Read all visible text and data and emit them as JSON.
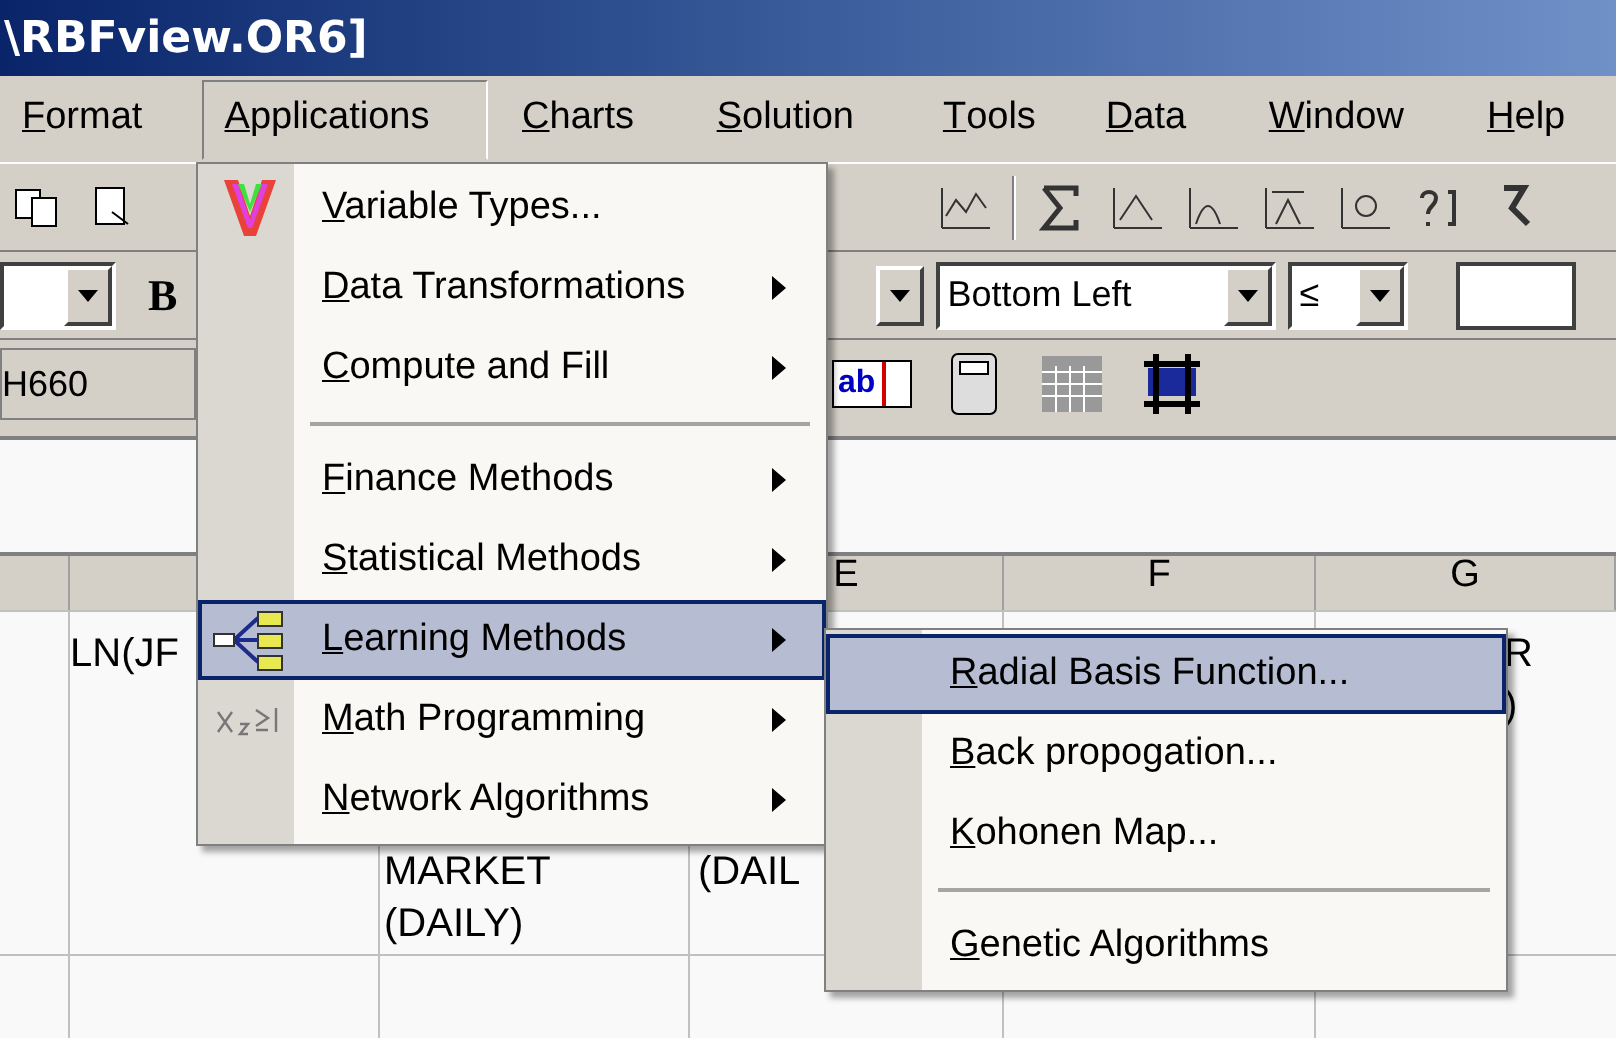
{
  "window": {
    "title": "\\RBFview.OR6]"
  },
  "menubar": [
    {
      "label": "Format",
      "selected": false
    },
    {
      "label": "Applications",
      "selected": true
    },
    {
      "label": "Charts",
      "selected": false
    },
    {
      "label": "Solution",
      "selected": false
    },
    {
      "label": "Tools",
      "selected": false
    },
    {
      "label": "Data",
      "selected": false
    },
    {
      "label": "Window",
      "selected": false
    },
    {
      "label": "Help",
      "selected": false
    }
  ],
  "format_toolbar": {
    "bold_label": "B",
    "position_value": "Bottom Left",
    "operator_value": "≤"
  },
  "cell_reference": "H660",
  "text_tool_label": "ab",
  "sheet": {
    "columns": [
      "E",
      "F",
      "G"
    ],
    "cells": [
      "LN(JF",
      "MARKET\n(DAILY)",
      "(DAIL",
      "R\n)"
    ]
  },
  "applications_menu": [
    {
      "kind": "logo_item",
      "label": "Variable Types...",
      "submenu": false,
      "selected": false
    },
    {
      "kind": "item",
      "label": "Data Transformations",
      "submenu": true,
      "selected": false
    },
    {
      "kind": "item",
      "label": "Compute and Fill",
      "submenu": true,
      "selected": false
    },
    {
      "kind": "separator"
    },
    {
      "kind": "item",
      "label": "Finance Methods",
      "submenu": true,
      "selected": false
    },
    {
      "kind": "item",
      "label": "Statistical Methods",
      "submenu": true,
      "selected": false
    },
    {
      "kind": "tree_item",
      "label": "Learning Methods",
      "submenu": true,
      "selected": true
    },
    {
      "kind": "formula_item",
      "label": "Math Programming",
      "submenu": true,
      "selected": false
    },
    {
      "kind": "item",
      "label": "Network Algorithms",
      "submenu": true,
      "selected": false
    }
  ],
  "learning_submenu": [
    {
      "kind": "item",
      "label": "Radial Basis Function...",
      "submenu": false,
      "selected": true
    },
    {
      "kind": "item",
      "label": "Back propogation...",
      "submenu": false,
      "selected": false
    },
    {
      "kind": "item",
      "label": "Kohonen Map...",
      "submenu": false,
      "selected": false
    },
    {
      "kind": "separator"
    },
    {
      "kind": "item",
      "label": "Genetic Algorithms",
      "submenu": false,
      "selected": false
    }
  ]
}
